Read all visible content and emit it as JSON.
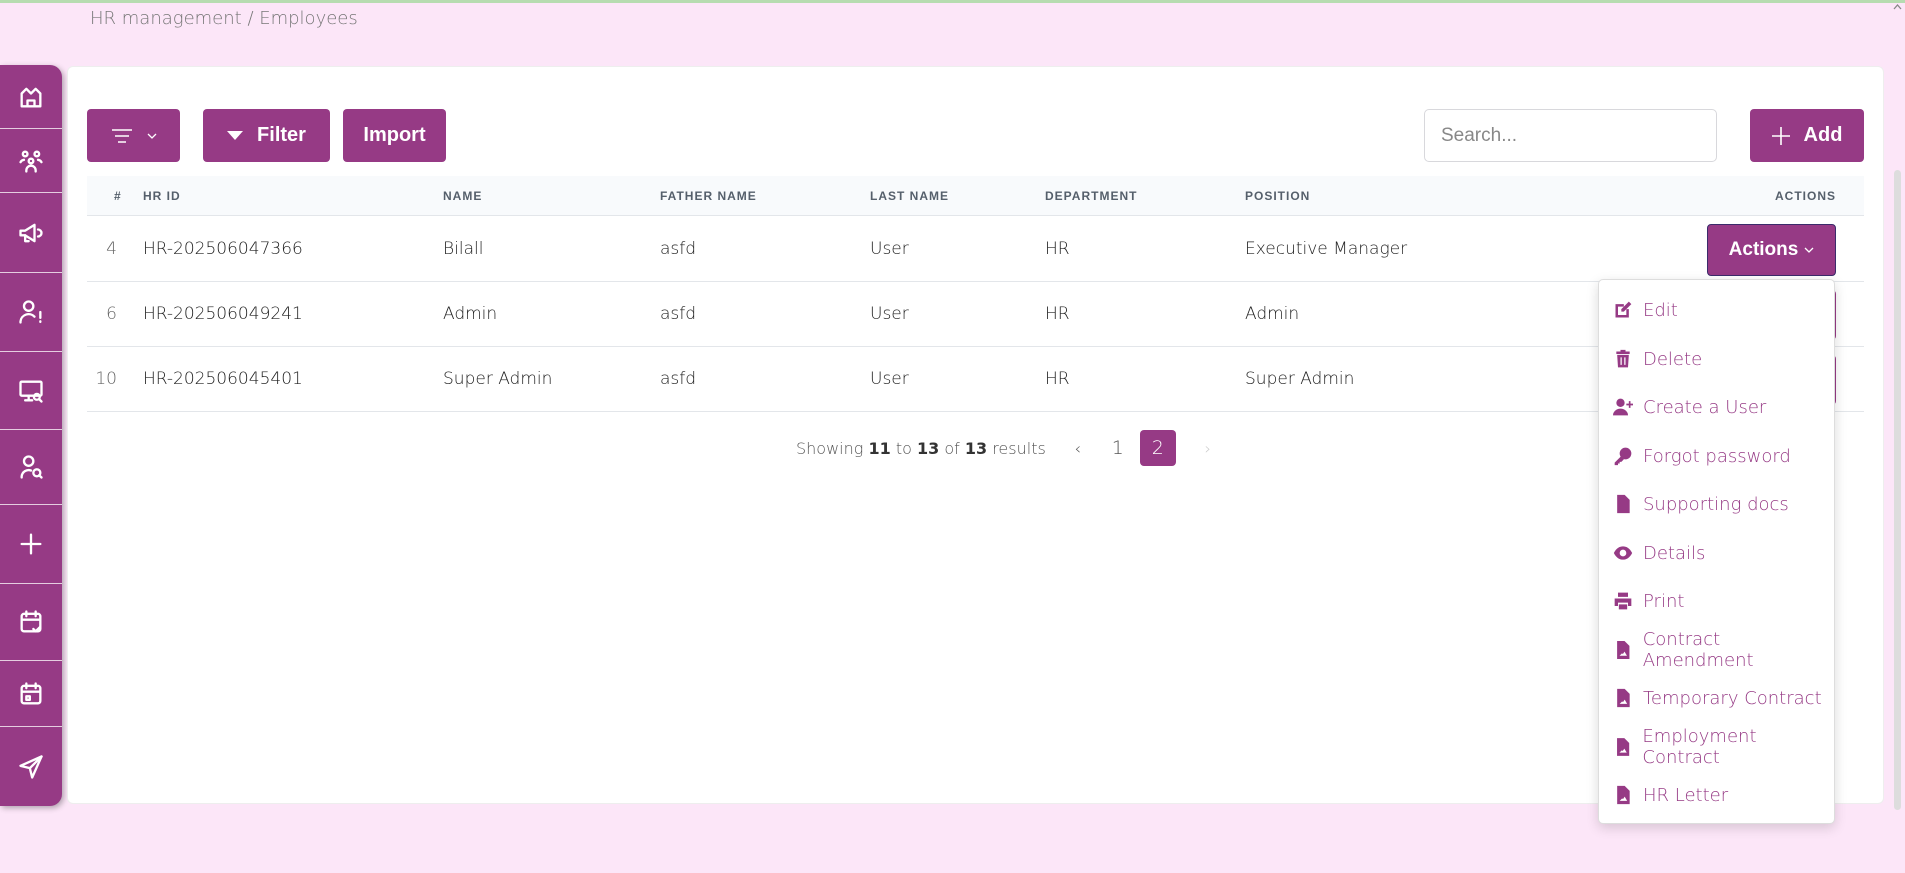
{
  "breadcrumb": "HR management / Employees",
  "sidebar": {
    "items": [
      "home-icon",
      "users-group-icon",
      "megaphone-icon",
      "user-alert-icon",
      "monitor-search-icon",
      "user-search-icon",
      "plus-icon",
      "calendar-check-icon",
      "calendar-icon",
      "send-icon"
    ]
  },
  "toolbar": {
    "filter_label": "Filter",
    "import_label": "Import",
    "search_placeholder": "Search...",
    "add_label": "Add"
  },
  "table": {
    "headers": [
      "#",
      "HR ID",
      "NAME",
      "FATHER NAME",
      "LAST NAME",
      "DEPARTMENT",
      "POSITION",
      "ACTIONS"
    ],
    "rows": [
      {
        "num": "4",
        "hr_id": "HR-202506047366",
        "name": "Bilall",
        "father": "asfd",
        "last": "User",
        "dept": "HR",
        "position": "Executive Manager"
      },
      {
        "num": "6",
        "hr_id": "HR-202506049241",
        "name": "Admin",
        "father": "asfd",
        "last": "User",
        "dept": "HR",
        "position": "Admin"
      },
      {
        "num": "10",
        "hr_id": "HR-202506045401",
        "name": "Super Admin",
        "father": "asfd",
        "last": "User",
        "dept": "HR",
        "position": "Super Admin"
      }
    ],
    "actions_label": "Actions"
  },
  "menu": [
    "Edit",
    "Delete",
    "Create a User",
    "Forgot password",
    "Supporting docs",
    "Details",
    "Print",
    "Contract Amendment",
    "Temporary Contract",
    "Employment Contract",
    "HR Letter"
  ],
  "pagination": {
    "showing": "Showing",
    "from": "11",
    "to_word": "to",
    "to": "13",
    "of_word": "of",
    "total": "13",
    "results": "results",
    "prev": "‹",
    "next": "›",
    "pages": [
      "1",
      "2"
    ],
    "current": "2"
  },
  "colors": {
    "accent": "#963a85",
    "background": "#fce6f8"
  }
}
